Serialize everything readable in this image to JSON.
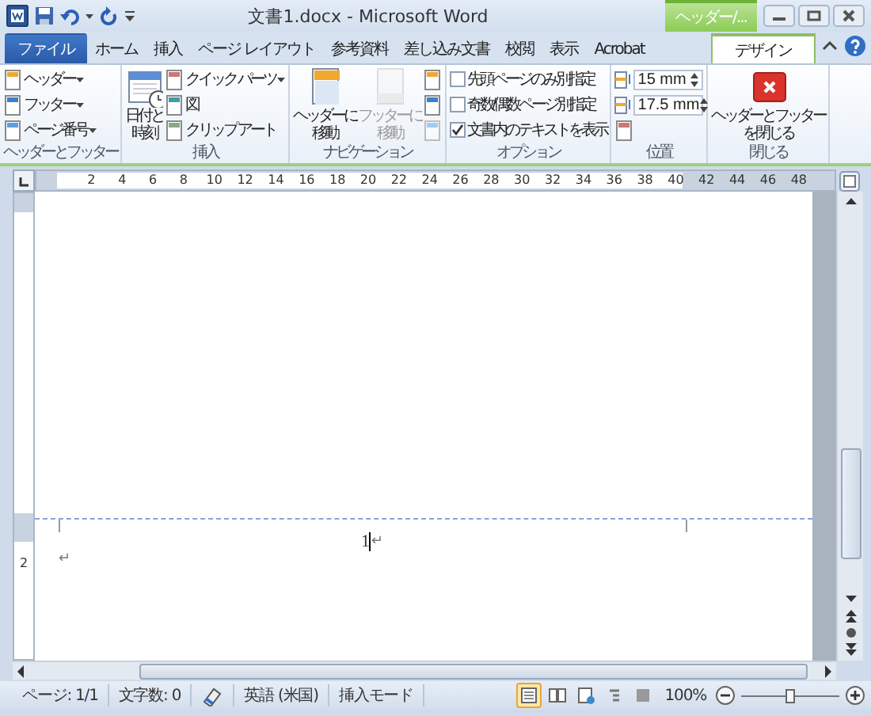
{
  "window": {
    "title": "文書1.docx - Microsoft Word"
  },
  "context_tab": {
    "label": "ヘッダー/..."
  },
  "tabs": [
    {
      "label": "ファイル",
      "kind": "file",
      "selected": false
    },
    {
      "label": "ホーム",
      "kind": "normal",
      "selected": false
    },
    {
      "label": "挿入",
      "kind": "normal",
      "selected": false
    },
    {
      "label": "ページ レイアウト",
      "kind": "normal",
      "selected": false
    },
    {
      "label": "参考資料",
      "kind": "normal",
      "selected": false
    },
    {
      "label": "差し込み文書",
      "kind": "normal",
      "selected": false
    },
    {
      "label": "校閲",
      "kind": "normal",
      "selected": false
    },
    {
      "label": "表示",
      "kind": "normal",
      "selected": false
    },
    {
      "label": "Acrobat",
      "kind": "normal",
      "selected": false
    },
    {
      "label": "デザイン",
      "kind": "context",
      "selected": true
    }
  ],
  "ribbon": {
    "groups": [
      {
        "title": "ヘッダーとフッター",
        "items": [
          {
            "kind": "stack",
            "items": [
              {
                "kind": "small",
                "label": "ヘッダー",
                "dropdown": true,
                "disabled": false
              },
              {
                "kind": "small",
                "label": "フッター",
                "dropdown": true,
                "disabled": false
              },
              {
                "kind": "small",
                "label": "ページ番号",
                "dropdown": true,
                "disabled": false
              }
            ]
          }
        ]
      },
      {
        "title": "挿入",
        "items": [
          {
            "kind": "large",
            "lines": [
              "日付と",
              "時刻"
            ],
            "disabled": false
          },
          {
            "kind": "stack",
            "items": [
              {
                "kind": "small",
                "label": "クイック パーツ",
                "dropdown": true,
                "disabled": false
              },
              {
                "kind": "small",
                "label": "図",
                "dropdown": false,
                "disabled": false
              },
              {
                "kind": "small",
                "label": "クリップ アート",
                "dropdown": false,
                "disabled": false
              }
            ]
          }
        ]
      },
      {
        "title": "ナビゲーション",
        "items": [
          {
            "kind": "large",
            "lines": [
              "ヘッダーに",
              "移動"
            ],
            "disabled": false
          },
          {
            "kind": "large",
            "lines": [
              "フッターに",
              "移動"
            ],
            "disabled": true
          },
          {
            "kind": "stack",
            "items": [
              {
                "kind": "small",
                "dropdown": false,
                "disabled": false
              },
              {
                "kind": "small",
                "dropdown": false,
                "disabled": false
              },
              {
                "kind": "small",
                "dropdown": false,
                "disabled": true
              }
            ]
          }
        ]
      },
      {
        "title": "オプション",
        "items": [
          {
            "kind": "stack",
            "items": [
              {
                "kind": "check",
                "label": "先頭ページのみ別指定",
                "checked": false
              },
              {
                "kind": "check",
                "label": "奇数/偶数ページ別指定",
                "checked": false
              },
              {
                "kind": "check",
                "label": "文書内のテキストを表示",
                "checked": true
              }
            ]
          }
        ]
      },
      {
        "title": "位置",
        "items": [
          {
            "kind": "stack",
            "items": [
              {
                "kind": "spin",
                "value": "15 mm"
              },
              {
                "kind": "spin",
                "value": "17.5 mm"
              },
              {
                "kind": "small",
                "dropdown": false,
                "disabled": false
              }
            ]
          }
        ]
      },
      {
        "title": "閉じる",
        "items": [
          {
            "kind": "large",
            "lines": [
              "ヘッダーとフッター",
              "を閉じる"
            ],
            "disabled": false
          }
        ]
      }
    ]
  },
  "ruler": {
    "labels": [
      "2",
      "4",
      "6",
      "8",
      "10",
      "12",
      "14",
      "16",
      "18",
      "20",
      "22",
      "24",
      "26",
      "28",
      "30",
      "32",
      "34",
      "36",
      "38",
      "40",
      "42",
      "44",
      "46",
      "48"
    ]
  },
  "vertical_ruler": {
    "labels": [
      "2"
    ]
  },
  "footer": {
    "paragraphs": [
      {
        "text": "1",
        "mark": "↵",
        "centered": true,
        "cursor": true
      },
      {
        "mark": "↵",
        "centered": false,
        "cursor": false
      }
    ]
  },
  "status_bar": {
    "page": "ページ: 1/1",
    "words": "文字数: 0",
    "language": "英語 (米国)",
    "mode": "挿入モード",
    "views": [
      {
        "selected": true
      },
      {
        "selected": false
      },
      {
        "selected": false
      },
      {
        "selected": false
      },
      {
        "selected": false
      }
    ],
    "zoom": "100%",
    "zoom_slider": {
      "level": 0.5
    }
  }
}
